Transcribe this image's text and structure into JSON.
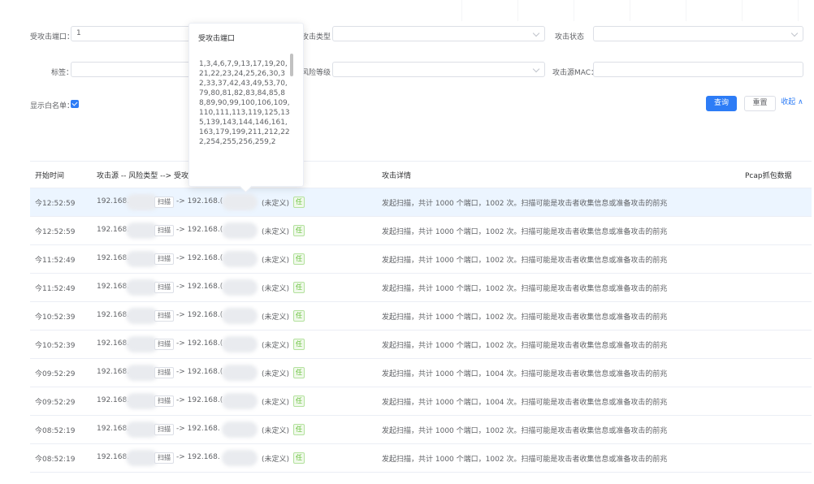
{
  "filters": {
    "port_label": "受攻击端口：",
    "port_value": "1",
    "type_label": "攻击类型",
    "status_label": "攻击状态",
    "tag_label": "标签：",
    "level_label": "风险等级",
    "mac_label": "攻击源MAC：",
    "whitelist_label": "显示白名单："
  },
  "buttons": {
    "search": "查询",
    "reset": "重置",
    "collapse": "收起 ∧"
  },
  "popover": {
    "title": "受攻击端口",
    "ports": "1,3,4,6,7,9,13,17,19,20,21,22,23,24,25,26,30,32,33,37,42,43,49,53,70,79,80,81,82,83,84,85,88,89,90,99,100,106,109,110,111,113,119,125,135,139,143,144,146,161,163,179,199,211,212,222,254,255,256,259,2"
  },
  "table": {
    "headers": {
      "time": "开始时间",
      "flow": "攻击源 -- 风险类型 --> 受攻击",
      "detail": "攻击详情",
      "pcap": "Pcap抓包数据"
    },
    "rows": [
      {
        "time": "今12:52:59",
        "src": "192.168.",
        "type": "扫描",
        "dst": "-> 192.168.(",
        "undef": "(未定义)",
        "detail": "发起扫描，共计 1000 个端口，1002 次。扫描可能是攻击者收集信息或准备攻击的前兆",
        "highlight": true
      },
      {
        "time": "今12:52:59",
        "src": "192.168.",
        "type": "扫描",
        "dst": "-> 192.168.(",
        "undef": "(未定义)",
        "detail": "发起扫描，共计 1000 个端口，1002 次。扫描可能是攻击者收集信息或准备攻击的前兆",
        "highlight": false
      },
      {
        "time": "今11:52:49",
        "src": "192.168.",
        "type": "扫描",
        "dst": "-> 192.168.(",
        "undef": "(未定义)",
        "detail": "发起扫描，共计 1000 个端口，1002 次。扫描可能是攻击者收集信息或准备攻击的前兆",
        "highlight": false
      },
      {
        "time": "今11:52:49",
        "src": "192.168.",
        "type": "扫描",
        "dst": "-> 192.168.(",
        "undef": "(未定义)",
        "detail": "发起扫描，共计 1000 个端口，1002 次。扫描可能是攻击者收集信息或准备攻击的前兆",
        "highlight": false
      },
      {
        "time": "今10:52:39",
        "src": "192.168.",
        "type": "扫描",
        "dst": "-> 192.168.(",
        "undef": "(未定义)",
        "detail": "发起扫描，共计 1000 个端口，1002 次。扫描可能是攻击者收集信息或准备攻击的前兆",
        "highlight": false
      },
      {
        "time": "今10:52:39",
        "src": "192.168.",
        "type": "扫描",
        "dst": "-> 192.168.(",
        "undef": "(未定义)",
        "detail": "发起扫描，共计 1000 个端口，1002 次。扫描可能是攻击者收集信息或准备攻击的前兆",
        "highlight": false
      },
      {
        "time": "今09:52:29",
        "src": "192.168.",
        "type": "扫描",
        "dst": "-> 192.168.(",
        "undef": "(未定义)",
        "detail": "发起扫描，共计 1000 个端口，1004 次。扫描可能是攻击者收集信息或准备攻击的前兆",
        "highlight": false
      },
      {
        "time": "今09:52:29",
        "src": "192.168.",
        "type": "扫描",
        "dst": "-> 192.168.(",
        "undef": "(未定义)",
        "detail": "发起扫描，共计 1000 个端口，1004 次。扫描可能是攻击者收集信息或准备攻击的前兆",
        "highlight": false
      },
      {
        "time": "今08:52:19",
        "src": "192.168.",
        "type": "扫描",
        "dst": "-> 192.168.",
        "undef": "(未定义)",
        "detail": "发起扫描，共计 1000 个端口，1002 次。扫描可能是攻击者收集信息或准备攻击的前兆",
        "highlight": false
      },
      {
        "time": "今08:52:19",
        "src": "192.168.",
        "type": "扫描",
        "dst": "-> 192.168.",
        "undef": "(未定义)",
        "detail": "发起扫描，共计 1000 个端口，1002 次。扫描可能是攻击者收集信息或准备攻击的前兆",
        "highlight": false
      }
    ],
    "tag_glyph": "任"
  },
  "colors": {
    "primary": "#2d7cf6",
    "row_highlight": "#ecf5ff",
    "success": "#67c23a"
  }
}
